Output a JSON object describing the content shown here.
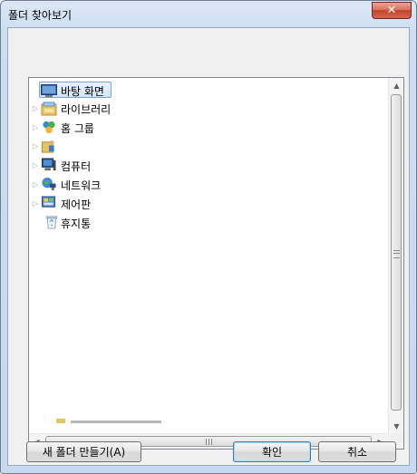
{
  "window": {
    "title": "폴더 찾아보기",
    "close_glyph": "✕"
  },
  "tree": {
    "items": [
      {
        "label": "바탕 화면",
        "icon": "desktop-icon",
        "expander": false,
        "selected": true
      },
      {
        "label": "라이브러리",
        "icon": "library-icon",
        "expander": true
      },
      {
        "label": "홈 그룹",
        "icon": "homegroup-icon",
        "expander": true
      },
      {
        "label": "",
        "icon": "user-folder-icon",
        "expander": true
      },
      {
        "label": "컴퓨터",
        "icon": "computer-icon",
        "expander": true
      },
      {
        "label": "네트워크",
        "icon": "network-icon",
        "expander": true
      },
      {
        "label": "제어판",
        "icon": "control-panel-icon",
        "expander": true
      },
      {
        "label": "휴지통",
        "icon": "recycle-bin-icon",
        "expander": false
      }
    ]
  },
  "buttons": {
    "new_folder": "새 폴더 만들기(A)",
    "ok": "확인",
    "cancel": "취소"
  },
  "scroll": {
    "up_glyph": "▲",
    "down_glyph": "▼",
    "left_glyph": "◀",
    "right_glyph": "▶"
  },
  "colors": {
    "selection_border": "#7da2ce",
    "default_button_border": "#3c7fb1",
    "close_button": "#c4432a"
  }
}
